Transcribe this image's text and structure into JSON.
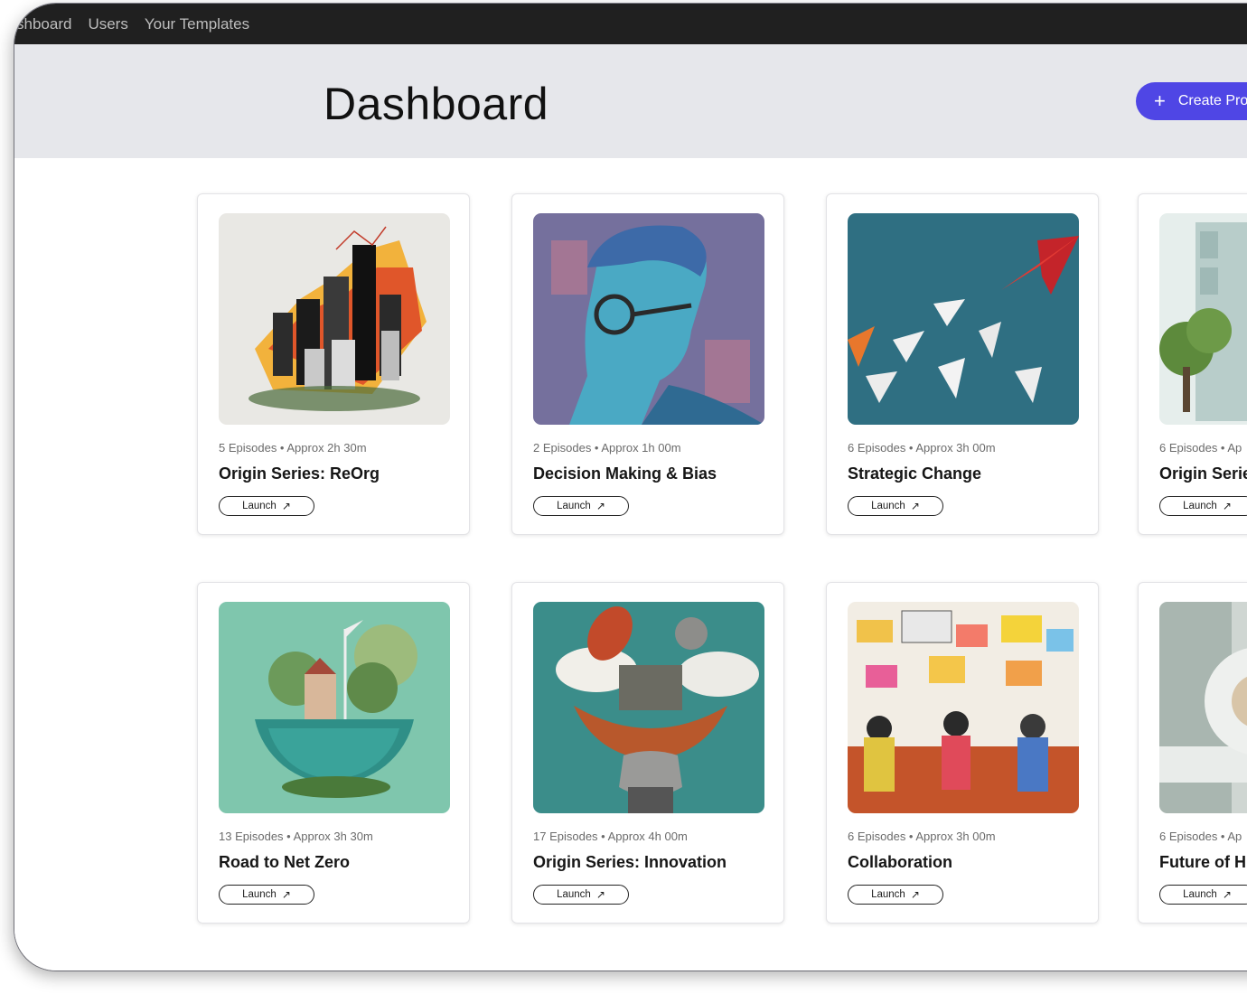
{
  "nav": {
    "items": [
      "shboard",
      "Users",
      "Your Templates"
    ]
  },
  "header": {
    "title": "Dashboard",
    "create_label": "Create Proj",
    "accent": "#4f46e5"
  },
  "cards": [
    {
      "meta": "5 Episodes • Approx 2h 30m",
      "title": "Origin Series: ReOrg",
      "launch": "Launch"
    },
    {
      "meta": "2 Episodes • Approx 1h 00m",
      "title": "Decision Making & Bias",
      "launch": "Launch"
    },
    {
      "meta": "6 Episodes • Approx 3h 00m",
      "title": "Strategic Change",
      "launch": "Launch"
    },
    {
      "meta": "6 Episodes • Ap",
      "title": "Origin Serie",
      "launch": "Launch"
    },
    {
      "meta": "13 Episodes • Approx 3h 30m",
      "title": "Road to Net Zero",
      "launch": "Launch"
    },
    {
      "meta": "17 Episodes • Approx 4h 00m",
      "title": "Origin Series: Innovation",
      "launch": "Launch"
    },
    {
      "meta": "6 Episodes • Approx 3h 00m",
      "title": "Collaboration",
      "launch": "Launch"
    },
    {
      "meta": "6 Episodes • Ap",
      "title": "Future of H",
      "launch": "Launch"
    }
  ]
}
